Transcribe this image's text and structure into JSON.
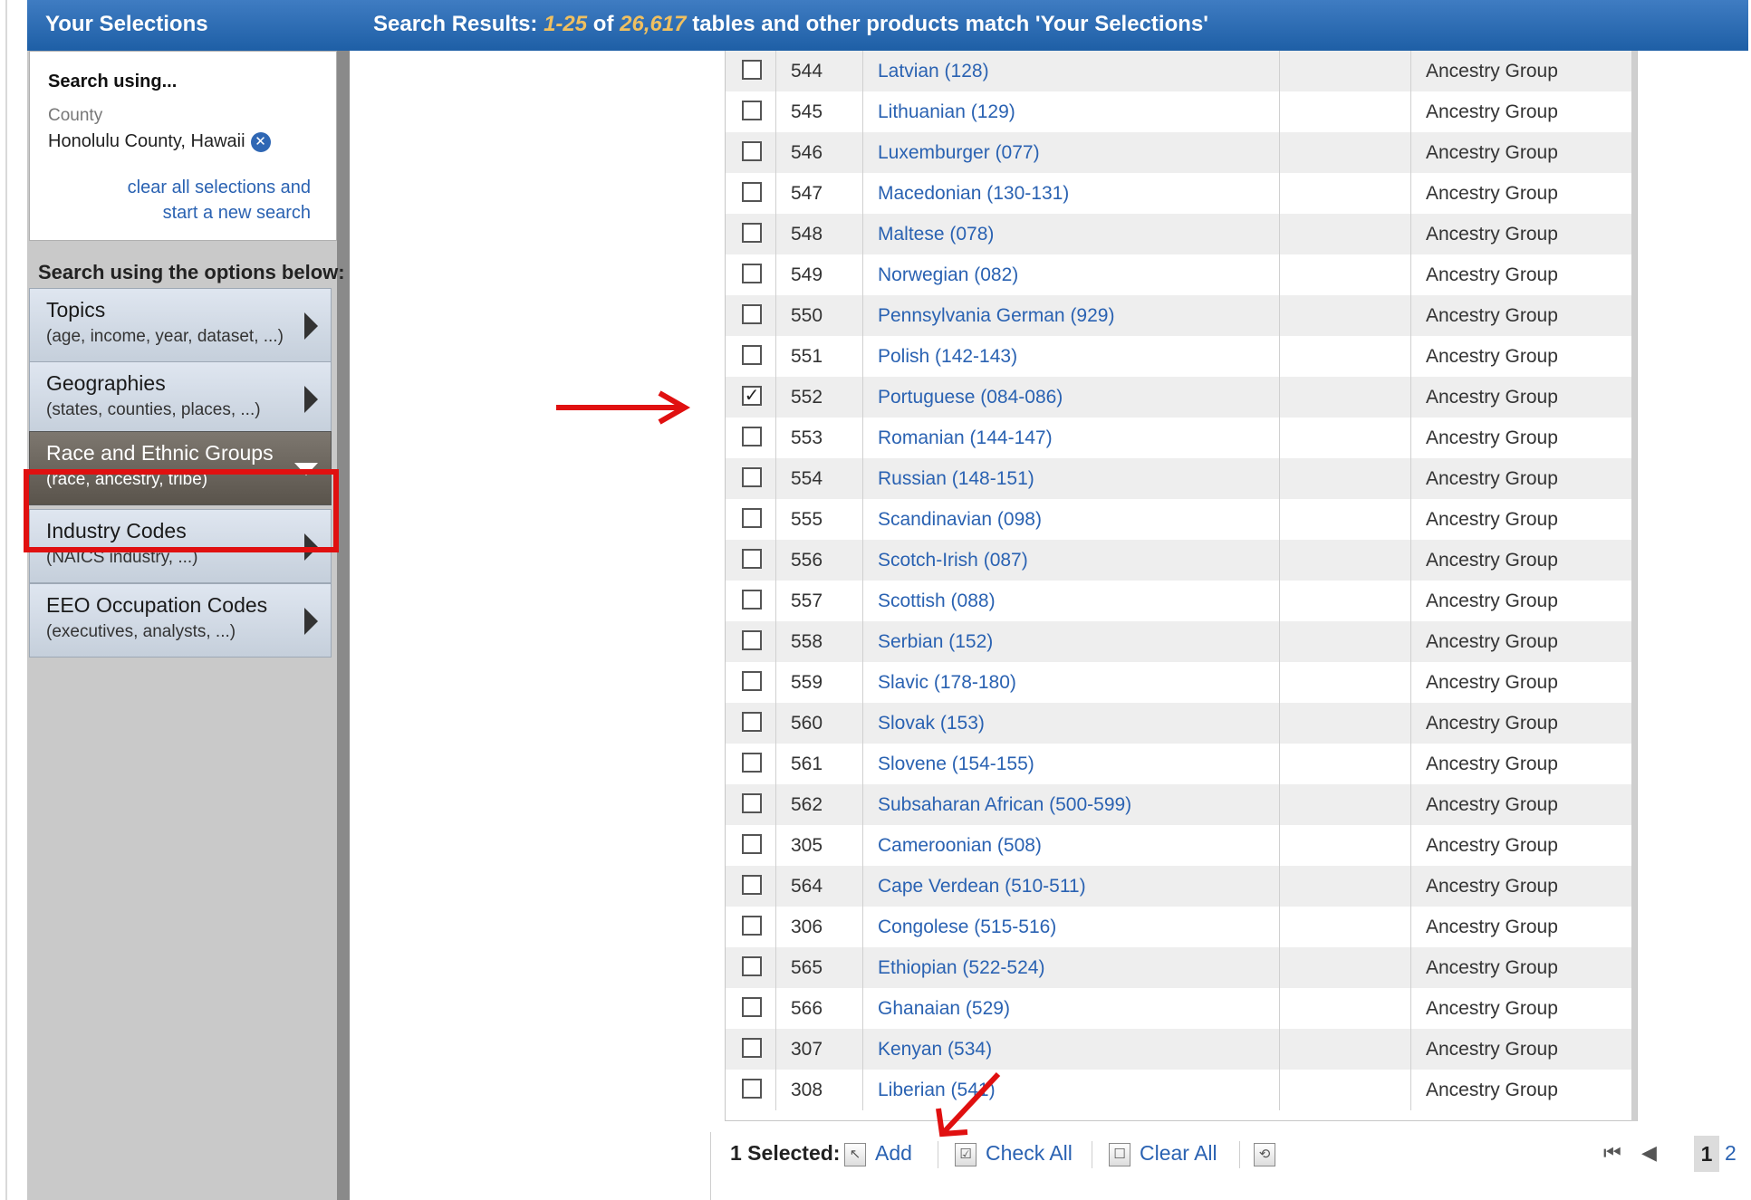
{
  "header": {
    "left_title": "Your Selections",
    "results_prefix": "Search Results: ",
    "results_range": "1-25",
    "results_of": " of ",
    "results_total": "26,617",
    "results_suffix": " tables and other products match 'Your Selections'"
  },
  "selections": {
    "search_using": "Search using...",
    "county_label": "County",
    "county_value": "Honolulu County, Hawaii",
    "remove_icon": "x-circle-icon",
    "clear_link": "clear all selections and start a new search"
  },
  "options_label": "Search using the options below:",
  "categories": [
    {
      "title": "Topics",
      "sub": "(age, income, year, dataset, ...)"
    },
    {
      "title": "Geographies",
      "sub": "(states, counties, places, ...)"
    },
    {
      "title": "Race and Ethnic Groups",
      "sub": "(race, ancestry, tribe)"
    },
    {
      "title": "Industry Codes",
      "sub": "(NAICS industry, ...)"
    },
    {
      "title": "EEO Occupation Codes",
      "sub": "(executives, analysts, ...)"
    }
  ],
  "table": {
    "rows": [
      {
        "checked": false,
        "id": "544",
        "name": "Latvian (128)",
        "type": "Ancestry Group"
      },
      {
        "checked": false,
        "id": "545",
        "name": "Lithuanian (129)",
        "type": "Ancestry Group"
      },
      {
        "checked": false,
        "id": "546",
        "name": "Luxemburger (077)",
        "type": "Ancestry Group"
      },
      {
        "checked": false,
        "id": "547",
        "name": "Macedonian (130-131)",
        "type": "Ancestry Group"
      },
      {
        "checked": false,
        "id": "548",
        "name": "Maltese (078)",
        "type": "Ancestry Group"
      },
      {
        "checked": false,
        "id": "549",
        "name": "Norwegian (082)",
        "type": "Ancestry Group"
      },
      {
        "checked": false,
        "id": "550",
        "name": "Pennsylvania German (929)",
        "type": "Ancestry Group"
      },
      {
        "checked": false,
        "id": "551",
        "name": "Polish (142-143)",
        "type": "Ancestry Group"
      },
      {
        "checked": true,
        "id": "552",
        "name": "Portuguese (084-086)",
        "type": "Ancestry Group"
      },
      {
        "checked": false,
        "id": "553",
        "name": "Romanian (144-147)",
        "type": "Ancestry Group"
      },
      {
        "checked": false,
        "id": "554",
        "name": "Russian (148-151)",
        "type": "Ancestry Group"
      },
      {
        "checked": false,
        "id": "555",
        "name": "Scandinavian (098)",
        "type": "Ancestry Group"
      },
      {
        "checked": false,
        "id": "556",
        "name": "Scotch-Irish (087)",
        "type": "Ancestry Group"
      },
      {
        "checked": false,
        "id": "557",
        "name": "Scottish (088)",
        "type": "Ancestry Group"
      },
      {
        "checked": false,
        "id": "558",
        "name": "Serbian (152)",
        "type": "Ancestry Group"
      },
      {
        "checked": false,
        "id": "559",
        "name": "Slavic (178-180)",
        "type": "Ancestry Group"
      },
      {
        "checked": false,
        "id": "560",
        "name": "Slovak (153)",
        "type": "Ancestry Group"
      },
      {
        "checked": false,
        "id": "561",
        "name": "Slovene (154-155)",
        "type": "Ancestry Group"
      },
      {
        "checked": false,
        "id": "562",
        "name": "Subsaharan African (500-599)",
        "type": "Ancestry Group"
      },
      {
        "checked": false,
        "id": "305",
        "name": "Cameroonian (508)",
        "type": "Ancestry Group"
      },
      {
        "checked": false,
        "id": "564",
        "name": "Cape Verdean (510-511)",
        "type": "Ancestry Group"
      },
      {
        "checked": false,
        "id": "306",
        "name": "Congolese (515-516)",
        "type": "Ancestry Group"
      },
      {
        "checked": false,
        "id": "565",
        "name": "Ethiopian (522-524)",
        "type": "Ancestry Group"
      },
      {
        "checked": false,
        "id": "566",
        "name": "Ghanaian (529)",
        "type": "Ancestry Group"
      },
      {
        "checked": false,
        "id": "307",
        "name": "Kenyan (534)",
        "type": "Ancestry Group"
      },
      {
        "checked": false,
        "id": "308",
        "name": "Liberian (541)",
        "type": "Ancestry Group"
      }
    ]
  },
  "toolbar": {
    "selected": "1 Selected:",
    "add": "Add",
    "check_all": "Check All",
    "clear_all": "Clear All",
    "refresh_icon": "refresh-icon",
    "page_current": "1",
    "page_next": "2"
  },
  "colors": {
    "header_blue": "#1e5fa6",
    "link_blue": "#2a62b2",
    "highlight_red": "#e01010"
  }
}
